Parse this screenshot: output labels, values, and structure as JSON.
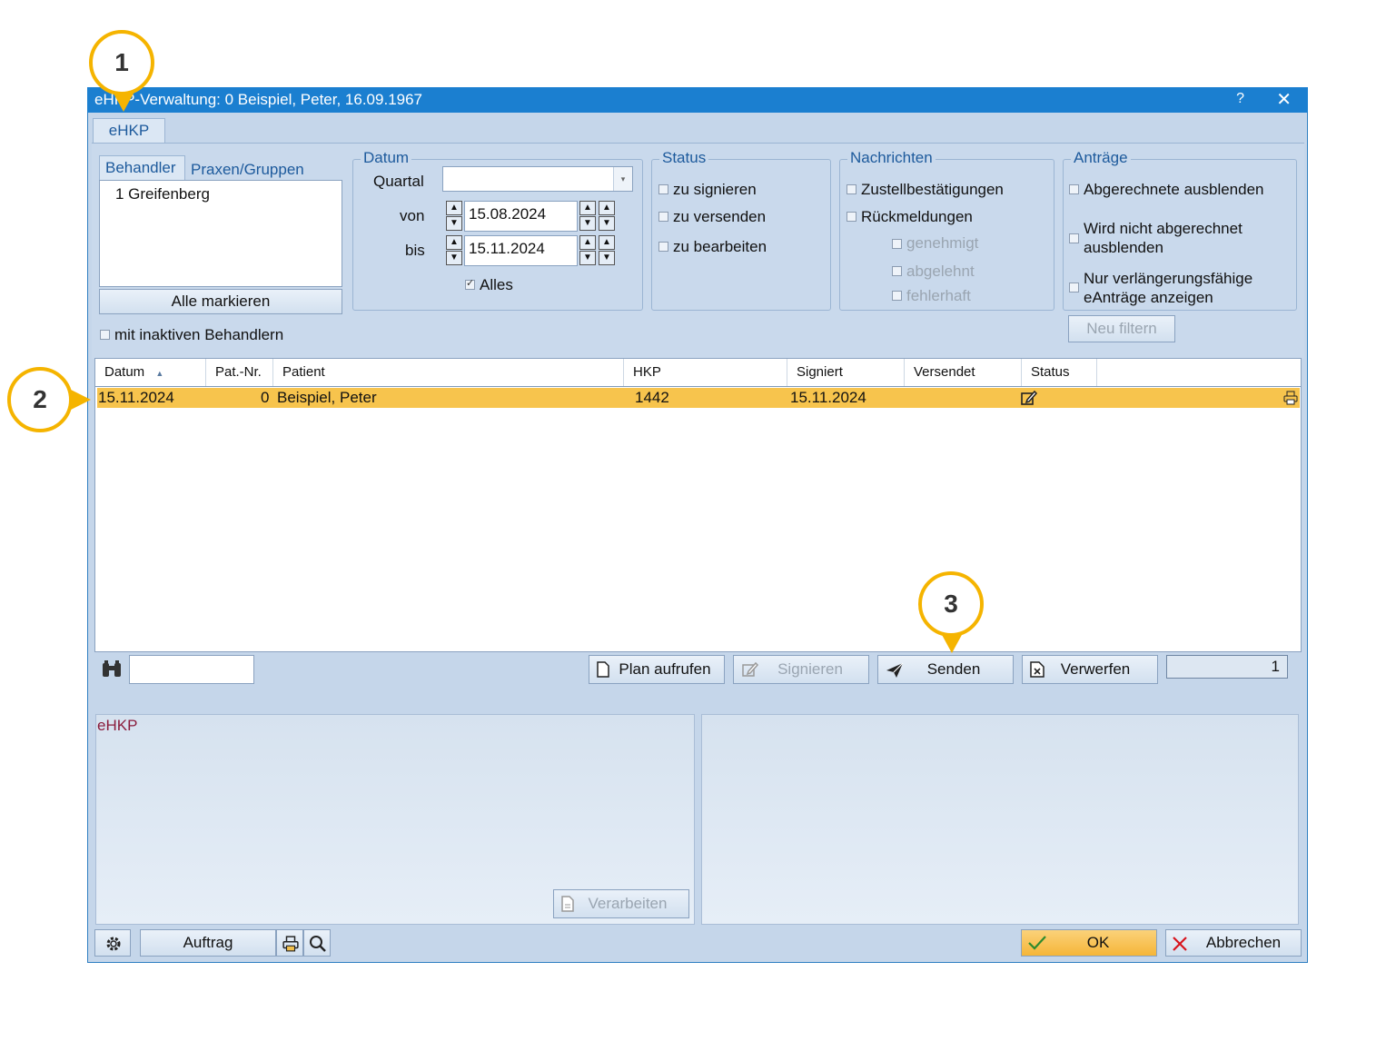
{
  "titlebar": {
    "title": "eHKP-Verwaltung: 0 Beispiel, Peter, 16.09.1967",
    "help": "?",
    "close": "✕"
  },
  "tabs": {
    "main": "eHKP"
  },
  "behandler": {
    "tab_behandler": "Behandler",
    "tab_praxen": "Praxen/Gruppen",
    "list": [
      "1 Greifenberg"
    ],
    "mark_all": "Alle markieren",
    "inactive": "mit inaktiven Behandlern"
  },
  "datum": {
    "legend": "Datum",
    "quartal_label": "Quartal",
    "quartal_value": "",
    "von_label": "von",
    "von_value": "15.08.2024",
    "bis_label": "bis",
    "bis_value": "15.11.2024",
    "alles": "Alles"
  },
  "status": {
    "legend": "Status",
    "items": [
      "zu signieren",
      "zu versenden",
      "zu bearbeiten"
    ]
  },
  "nachrichten": {
    "legend": "Nachrichten",
    "items": [
      "Zustellbestätigungen",
      "Rückmeldungen"
    ],
    "sub_items": [
      "genehmigt",
      "abgelehnt",
      "fehlerhaft"
    ]
  },
  "antraege": {
    "legend": "Anträge",
    "item1": "Abgerechnete ausblenden",
    "item2_l1": "Wird nicht abgerechnet",
    "item2_l2": "ausblenden",
    "item3_l1": "Nur verlängerungsfähige",
    "item3_l2": "eAnträge anzeigen",
    "filter_button": "Neu filtern"
  },
  "table": {
    "columns": [
      "Datum",
      "Pat.-Nr.",
      "Patient",
      "HKP",
      "Signiert",
      "Versendet",
      "Status"
    ],
    "rows": [
      {
        "datum": "15.11.2024",
        "patnr": "0",
        "patient": "Beispiel, Peter",
        "hkp": "1442",
        "signiert": "15.11.2024",
        "versendet": ""
      }
    ]
  },
  "actions": {
    "plan": "Plan aufrufen",
    "signieren": "Signieren",
    "senden": "Senden",
    "verwerfen": "Verwerfen",
    "count": "1",
    "search_value": ""
  },
  "lower": {
    "left_title": "eHKP",
    "verarbeiten": "Verarbeiten"
  },
  "footer": {
    "auftrag": "Auftrag",
    "ok": "OK",
    "abbrechen": "Abbrechen"
  },
  "callouts": {
    "c1": "1",
    "c2": "2",
    "c3": "3"
  },
  "colors": {
    "titlebar": "#1b7fd0",
    "selected_row": "#f7c44d",
    "callout": "#f5b400",
    "accent_text": "#1d5a9c"
  }
}
